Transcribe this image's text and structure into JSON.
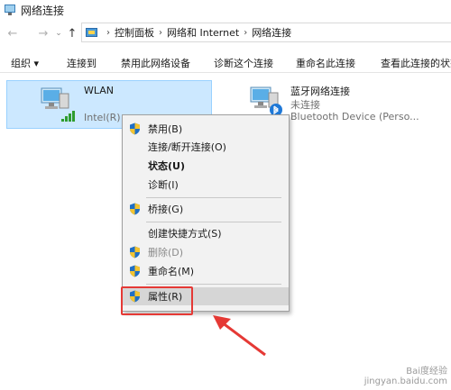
{
  "window": {
    "title": "网络连接"
  },
  "address": {
    "crumbs": [
      "控制面板",
      "网络和 Internet",
      "网络连接"
    ]
  },
  "toolbar": {
    "organize": "组织 ▾",
    "connect": "连接到",
    "disable": "禁用此网络设备",
    "diagnose": "诊断这个连接",
    "rename": "重命名此连接",
    "view_status": "查看此连接的状态"
  },
  "items": {
    "wlan": {
      "name": "WLAN",
      "sub": "Intel(R)"
    },
    "bt": {
      "name": "蓝牙网络连接",
      "status": "未连接",
      "device": "Bluetooth Device (Perso..."
    }
  },
  "menu": {
    "items": [
      {
        "label": "禁用(B)",
        "shield": true
      },
      {
        "label": "连接/断开连接(O)",
        "shield": false
      },
      {
        "label": "状态(U)",
        "shield": false,
        "bold": true
      },
      {
        "label": "诊断(I)",
        "shield": false
      },
      {
        "label": "桥接(G)",
        "shield": true
      },
      {
        "label": "创建快捷方式(S)",
        "shield": false
      },
      {
        "label": "删除(D)",
        "shield": true,
        "disabled": true
      },
      {
        "label": "重命名(M)",
        "shield": true
      },
      {
        "label": "属性(R)",
        "shield": true,
        "highlighted": true
      }
    ]
  },
  "watermark": {
    "line1": "Bai度经验",
    "line2": "jingyan.baidu.com"
  },
  "colors": {
    "selection": "#cce8ff",
    "annotation_red": "#e53935",
    "menu_bg": "#f2f2f2"
  }
}
